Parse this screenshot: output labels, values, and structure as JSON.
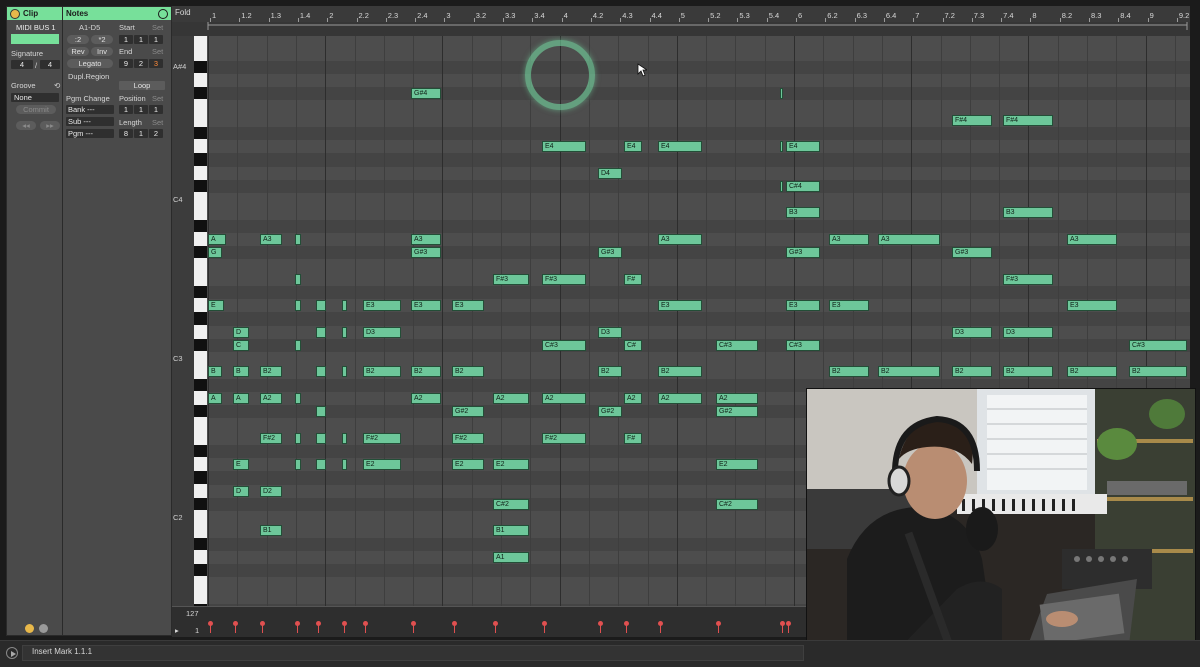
{
  "clip": {
    "header": "Clip",
    "name": "MIDI BUS 1",
    "signature_label": "Signature",
    "sig_num": "4",
    "sig_slash": "/",
    "sig_den": "4",
    "groove_label": "Groove",
    "groove_value": "None",
    "commit_label": "Commit",
    "nav_left": "◂◂",
    "nav_right": "▸▸"
  },
  "notes": {
    "header": "Notes",
    "range": "A1-D5",
    "half": ":2",
    "double": "*2",
    "rev": "Rev",
    "inv": "Inv",
    "legato": "Legato",
    "dupl_region": "Dupl.Region",
    "pgm_change": "Pgm Change",
    "bank": "Bank ---",
    "sub": "Sub ---",
    "pgm": "Pgm ---",
    "start_label": "Start",
    "start_set": "Set",
    "start": [
      "1",
      "1",
      "1"
    ],
    "end_label": "End",
    "end_set": "Set",
    "end": [
      "9",
      "2",
      "3"
    ],
    "loop": "Loop",
    "position_label": "Position",
    "position_set": "Set",
    "position": [
      "1",
      "1",
      "1"
    ],
    "length_label": "Length",
    "length_set": "Set",
    "length": [
      "8",
      "1",
      "2"
    ]
  },
  "piano_roll": {
    "fold": "Fold",
    "ruler_labels": [
      "1",
      "1.2",
      "1.3",
      "1.4",
      "2",
      "2.2",
      "2.3",
      "2.4",
      "3",
      "3.2",
      "3.3",
      "3.4",
      "4",
      "4.2",
      "4.3",
      "4.4",
      "5",
      "5.2",
      "5.3",
      "5.4",
      "6",
      "6.2",
      "6.3",
      "6.4",
      "7",
      "7.2",
      "7.3",
      "7.4",
      "8",
      "8.2",
      "8.3",
      "8.4",
      "9",
      "9.2"
    ],
    "octave_labels": [
      "A#4",
      "C4",
      "C3",
      "C2"
    ],
    "velocity_max": "127",
    "velocity_min": "1",
    "notes": [
      {
        "label": "G#4",
        "col": 411,
        "row": 3,
        "w": 30
      },
      {
        "label": "",
        "col": 780,
        "row": 3,
        "w": 3
      },
      {
        "label": "F#4",
        "col": 952,
        "row": 5,
        "w": 40
      },
      {
        "label": "F#4",
        "col": 1003,
        "row": 5,
        "w": 50
      },
      {
        "label": "E4",
        "col": 542,
        "row": 7,
        "w": 44
      },
      {
        "label": "E4",
        "col": 624,
        "row": 7,
        "w": 18
      },
      {
        "label": "E4",
        "col": 658,
        "row": 7,
        "w": 44
      },
      {
        "label": "",
        "col": 780,
        "row": 7,
        "w": 3
      },
      {
        "label": "E4",
        "col": 786,
        "row": 7,
        "w": 34
      },
      {
        "label": "D4",
        "col": 598,
        "row": 9,
        "w": 24
      },
      {
        "label": "",
        "col": 780,
        "row": 10,
        "w": 3
      },
      {
        "label": "C#4",
        "col": 786,
        "row": 10,
        "w": 34
      },
      {
        "label": "B3",
        "col": 786,
        "row": 12,
        "w": 34
      },
      {
        "label": "B3",
        "col": 1003,
        "row": 12,
        "w": 50
      },
      {
        "label": "A",
        "col": 208,
        "row": 14,
        "w": 18
      },
      {
        "label": "A3",
        "col": 260,
        "row": 14,
        "w": 22
      },
      {
        "label": "",
        "col": 295,
        "row": 14,
        "w": 6
      },
      {
        "label": "A3",
        "col": 411,
        "row": 14,
        "w": 30
      },
      {
        "label": "A3",
        "col": 658,
        "row": 14,
        "w": 44
      },
      {
        "label": "A3",
        "col": 829,
        "row": 14,
        "w": 40
      },
      {
        "label": "A3",
        "col": 878,
        "row": 14,
        "w": 62
      },
      {
        "label": "A3",
        "col": 1067,
        "row": 14,
        "w": 50
      },
      {
        "label": "G",
        "col": 208,
        "row": 15,
        "w": 14
      },
      {
        "label": "G#3",
        "col": 411,
        "row": 15,
        "w": 30
      },
      {
        "label": "G#3",
        "col": 598,
        "row": 15,
        "w": 24
      },
      {
        "label": "G#3",
        "col": 786,
        "row": 15,
        "w": 34
      },
      {
        "label": "G#3",
        "col": 952,
        "row": 15,
        "w": 40
      },
      {
        "label": "",
        "col": 295,
        "row": 17,
        "w": 6
      },
      {
        "label": "F#3",
        "col": 493,
        "row": 17,
        "w": 36
      },
      {
        "label": "F#3",
        "col": 542,
        "row": 17,
        "w": 44
      },
      {
        "label": "F#",
        "col": 624,
        "row": 17,
        "w": 18
      },
      {
        "label": "F#3",
        "col": 1003,
        "row": 17,
        "w": 50
      },
      {
        "label": "E",
        "col": 208,
        "row": 19,
        "w": 16
      },
      {
        "label": "",
        "col": 295,
        "row": 19,
        "w": 6
      },
      {
        "label": "",
        "col": 316,
        "row": 19,
        "w": 10
      },
      {
        "label": "",
        "col": 342,
        "row": 19,
        "w": 5
      },
      {
        "label": "E3",
        "col": 363,
        "row": 19,
        "w": 38
      },
      {
        "label": "E3",
        "col": 411,
        "row": 19,
        "w": 30
      },
      {
        "label": "E3",
        "col": 452,
        "row": 19,
        "w": 32
      },
      {
        "label": "E3",
        "col": 658,
        "row": 19,
        "w": 44
      },
      {
        "label": "E3",
        "col": 786,
        "row": 19,
        "w": 34
      },
      {
        "label": "E3",
        "col": 829,
        "row": 19,
        "w": 40
      },
      {
        "label": "E3",
        "col": 1067,
        "row": 19,
        "w": 50
      },
      {
        "label": "D",
        "col": 233,
        "row": 21,
        "w": 16
      },
      {
        "label": "",
        "col": 316,
        "row": 21,
        "w": 10
      },
      {
        "label": "",
        "col": 342,
        "row": 21,
        "w": 5
      },
      {
        "label": "D3",
        "col": 363,
        "row": 21,
        "w": 38
      },
      {
        "label": "D3",
        "col": 598,
        "row": 21,
        "w": 24
      },
      {
        "label": "D3",
        "col": 952,
        "row": 21,
        "w": 40
      },
      {
        "label": "D3",
        "col": 1003,
        "row": 21,
        "w": 50
      },
      {
        "label": "C",
        "col": 233,
        "row": 22,
        "w": 16
      },
      {
        "label": "",
        "col": 295,
        "row": 22,
        "w": 6
      },
      {
        "label": "C#3",
        "col": 542,
        "row": 22,
        "w": 44
      },
      {
        "label": "C#",
        "col": 624,
        "row": 22,
        "w": 18
      },
      {
        "label": "C#3",
        "col": 716,
        "row": 22,
        "w": 42
      },
      {
        "label": "C#3",
        "col": 786,
        "row": 22,
        "w": 34
      },
      {
        "label": "C#3",
        "col": 1129,
        "row": 22,
        "w": 58
      },
      {
        "label": "B",
        "col": 208,
        "row": 24,
        "w": 14
      },
      {
        "label": "B",
        "col": 233,
        "row": 24,
        "w": 16
      },
      {
        "label": "B2",
        "col": 260,
        "row": 24,
        "w": 22
      },
      {
        "label": "",
        "col": 316,
        "row": 24,
        "w": 10
      },
      {
        "label": "",
        "col": 342,
        "row": 24,
        "w": 5
      },
      {
        "label": "B2",
        "col": 363,
        "row": 24,
        "w": 38
      },
      {
        "label": "B2",
        "col": 411,
        "row": 24,
        "w": 30
      },
      {
        "label": "B2",
        "col": 452,
        "row": 24,
        "w": 32
      },
      {
        "label": "B2",
        "col": 598,
        "row": 24,
        "w": 24
      },
      {
        "label": "B2",
        "col": 658,
        "row": 24,
        "w": 44
      },
      {
        "label": "B2",
        "col": 829,
        "row": 24,
        "w": 40
      },
      {
        "label": "B2",
        "col": 878,
        "row": 24,
        "w": 62
      },
      {
        "label": "B2",
        "col": 952,
        "row": 24,
        "w": 40
      },
      {
        "label": "B2",
        "col": 1003,
        "row": 24,
        "w": 50
      },
      {
        "label": "B2",
        "col": 1067,
        "row": 24,
        "w": 50
      },
      {
        "label": "B2",
        "col": 1129,
        "row": 24,
        "w": 58
      },
      {
        "label": "A",
        "col": 208,
        "row": 26,
        "w": 14
      },
      {
        "label": "A",
        "col": 233,
        "row": 26,
        "w": 16
      },
      {
        "label": "A2",
        "col": 260,
        "row": 26,
        "w": 22
      },
      {
        "label": "",
        "col": 295,
        "row": 26,
        "w": 6
      },
      {
        "label": "A2",
        "col": 411,
        "row": 26,
        "w": 30
      },
      {
        "label": "A2",
        "col": 493,
        "row": 26,
        "w": 36
      },
      {
        "label": "A2",
        "col": 542,
        "row": 26,
        "w": 44
      },
      {
        "label": "A2",
        "col": 624,
        "row": 26,
        "w": 18
      },
      {
        "label": "A2",
        "col": 658,
        "row": 26,
        "w": 44
      },
      {
        "label": "A2",
        "col": 716,
        "row": 26,
        "w": 42
      },
      {
        "label": "",
        "col": 316,
        "row": 27,
        "w": 10
      },
      {
        "label": "G#2",
        "col": 452,
        "row": 27,
        "w": 32
      },
      {
        "label": "G#2",
        "col": 598,
        "row": 27,
        "w": 24
      },
      {
        "label": "G#2",
        "col": 716,
        "row": 27,
        "w": 42
      },
      {
        "label": "F#2",
        "col": 260,
        "row": 29,
        "w": 22
      },
      {
        "label": "",
        "col": 295,
        "row": 29,
        "w": 6
      },
      {
        "label": "",
        "col": 316,
        "row": 29,
        "w": 10
      },
      {
        "label": "",
        "col": 342,
        "row": 29,
        "w": 5
      },
      {
        "label": "F#2",
        "col": 363,
        "row": 29,
        "w": 38
      },
      {
        "label": "F#2",
        "col": 452,
        "row": 29,
        "w": 32
      },
      {
        "label": "F#2",
        "col": 542,
        "row": 29,
        "w": 44
      },
      {
        "label": "F#",
        "col": 624,
        "row": 29,
        "w": 18
      },
      {
        "label": "E",
        "col": 233,
        "row": 31,
        "w": 16
      },
      {
        "label": "",
        "col": 295,
        "row": 31,
        "w": 6
      },
      {
        "label": "",
        "col": 316,
        "row": 31,
        "w": 10
      },
      {
        "label": "",
        "col": 342,
        "row": 31,
        "w": 5
      },
      {
        "label": "E2",
        "col": 363,
        "row": 31,
        "w": 38
      },
      {
        "label": "E2",
        "col": 452,
        "row": 31,
        "w": 32
      },
      {
        "label": "E2",
        "col": 493,
        "row": 31,
        "w": 36
      },
      {
        "label": "E2",
        "col": 716,
        "row": 31,
        "w": 42
      },
      {
        "label": "D",
        "col": 233,
        "row": 33,
        "w": 16
      },
      {
        "label": "D2",
        "col": 260,
        "row": 33,
        "w": 22
      },
      {
        "label": "C#2",
        "col": 493,
        "row": 34,
        "w": 36
      },
      {
        "label": "C#2",
        "col": 716,
        "row": 34,
        "w": 42
      },
      {
        "label": "B1",
        "col": 260,
        "row": 36,
        "w": 22
      },
      {
        "label": "B1",
        "col": 493,
        "row": 36,
        "w": 36
      },
      {
        "label": "A1",
        "col": 493,
        "row": 38,
        "w": 36
      }
    ],
    "velocity_markers": [
      208,
      233,
      260,
      295,
      316,
      342,
      363,
      411,
      452,
      493,
      542,
      598,
      624,
      658,
      716,
      780,
      786
    ]
  },
  "status": {
    "message": "Insert Mark 1.1.1"
  },
  "colors": {
    "accent": "#77e09a",
    "note_fill": "#6dc79a",
    "velocity": "#e05050"
  }
}
